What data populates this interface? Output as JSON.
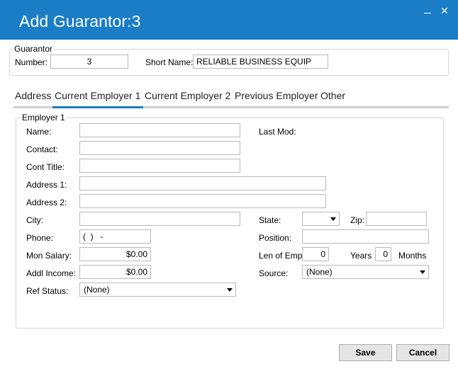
{
  "window": {
    "title": "Add Guarantor:3",
    "minimize_glyph": "—",
    "close_glyph": "✕"
  },
  "guarantor": {
    "legend": "Guarantor",
    "number_label": "Number:",
    "number_value": "3",
    "short_name_label": "Short Name:",
    "short_name_value": "RELIABLE BUSINESS EQUIP"
  },
  "tabs": [
    {
      "label": "Address"
    },
    {
      "label": "Current Employer 1"
    },
    {
      "label": "Current Employer 2"
    },
    {
      "label": "Previous Employer"
    },
    {
      "label": "Other"
    }
  ],
  "active_tab": "Current Employer 1",
  "employer": {
    "legend": "Employer 1",
    "name_label": "Name:",
    "name_value": "",
    "last_mod_label": "Last Mod:",
    "contact_label": "Contact:",
    "contact_value": "",
    "cont_title_label": "Cont Title:",
    "cont_title_value": "",
    "address1_label": "Address 1:",
    "address1_value": "",
    "address2_label": "Address 2:",
    "address2_value": "",
    "city_label": "City:",
    "city_value": "",
    "state_label": "State:",
    "state_value": "",
    "zip_label": "Zip:",
    "zip_value": "",
    "phone_label": "Phone:",
    "phone_value": "(  )   -",
    "position_label": "Position:",
    "position_value": "",
    "mon_salary_label": "Mon Salary:",
    "mon_salary_value": "$0.00",
    "len_emp_label": "Len of Emp:",
    "len_emp_years_value": "0",
    "years_label": "Years",
    "len_emp_months_value": "0",
    "months_label": "Months",
    "addl_income_label": "Addl Income:",
    "addl_income_value": "$0.00",
    "source_label": "Source:",
    "source_value": "(None)",
    "ref_status_label": "Ref Status:",
    "ref_status_value": "(None)"
  },
  "buttons": {
    "save": "Save",
    "cancel": "Cancel"
  },
  "colors": {
    "titlebar": "#1a7dc6",
    "active_tab_indicator": "#1a7dc6"
  }
}
